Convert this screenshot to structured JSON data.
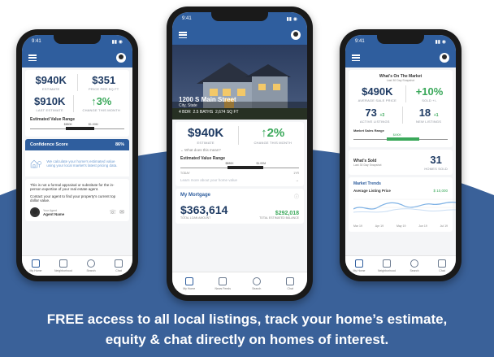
{
  "caption": {
    "line1": "FREE access to all local listings, track your home’s estimate,",
    "line2": "equity & chat directly on homes of interest."
  },
  "colors": {
    "brand_blue": "#2f5e9e",
    "dark_navy": "#1f3b63",
    "green": "#3aa85a",
    "band": "#3a6199"
  },
  "status": {
    "time": "9:41"
  },
  "tabs": {
    "home": "My Home",
    "news": "Neighborhood",
    "search": "Search",
    "chat": "Chat",
    "home_alt": "My Home",
    "news_alt": "News Feeds"
  },
  "left_phone": {
    "stats": [
      {
        "value": "$940K",
        "label": "ESTIMATE"
      },
      {
        "value": "$351",
        "label": "PRICE PER SQ FT"
      },
      {
        "value": "$910K",
        "label": "LAST ESTIMATE"
      },
      {
        "value": "↑3%",
        "label": "CHANGE THIS MONTH"
      }
    ],
    "range_label": "Estimated Value Range",
    "range_low": "$880K",
    "range_high": "$1.00M",
    "confidence_title": "Confidence Score",
    "confidence_value": "86%",
    "confidence_text": "We calculate your home's estimated value using your local market's latest pricing data.",
    "disclaimer": "This is not a formal appraisal or substitute for the in-person expertise of your real estate agent.",
    "contact": "Contact your agent to find your property's current top dollar value.",
    "agent_role": "Your Agent",
    "agent_name": "Agent Name"
  },
  "center_phone": {
    "address": "1200 S Main Street",
    "city": "City, State",
    "beds": "4 BDR",
    "baths": "2.5 BATHS",
    "sqft": "2,674 SQ FT",
    "estimate_value": "$940K",
    "estimate_label": "ESTIMATE",
    "change_value": "↑2%",
    "change_label": "CHANGE THIS MONTH",
    "what_mean": "What does this mean?",
    "range_label": "Estimated Value Range",
    "range_low": "$880K",
    "range_high": "$1.00M",
    "range_left": "TODAY",
    "range_right": "1YR",
    "learn_more": "Learn more about your home value",
    "mortgage_title": "My Mortgage",
    "loan_value": "$363,614",
    "loan_label": "TOTAL LOAN AMOUNT",
    "equity_value": "$292,018",
    "equity_label": "TOTAL ESTIMATED BALANCE"
  },
  "right_phone": {
    "market_title": "What's On The Market",
    "market_sub": "Last 30 Day Snapshot",
    "stats": [
      {
        "value": "$490K",
        "label": "AVERAGE SALE PRICE"
      },
      {
        "value": "+10%",
        "label": "SOLD +/-"
      },
      {
        "value": "73",
        "delta": "+3",
        "label": "ACTIVE LISTINGS"
      },
      {
        "value": "18",
        "delta": "+1",
        "label": "NEW LISTINGS"
      }
    ],
    "range_label": "Market Sales Range",
    "range_mid": "$490K",
    "sold_title": "What's Sold",
    "sold_sub": "Last 30 Day Snapshot",
    "sold_value": "31",
    "sold_label": "HOMES SOLD",
    "trends_title": "Market Trends",
    "trend_label": "Average Listing Price",
    "trend_value": "$ 10,000",
    "trend_months": [
      "Mar 19",
      "Apr 19",
      "May 19",
      "Jun 19",
      "Jul 19"
    ]
  }
}
